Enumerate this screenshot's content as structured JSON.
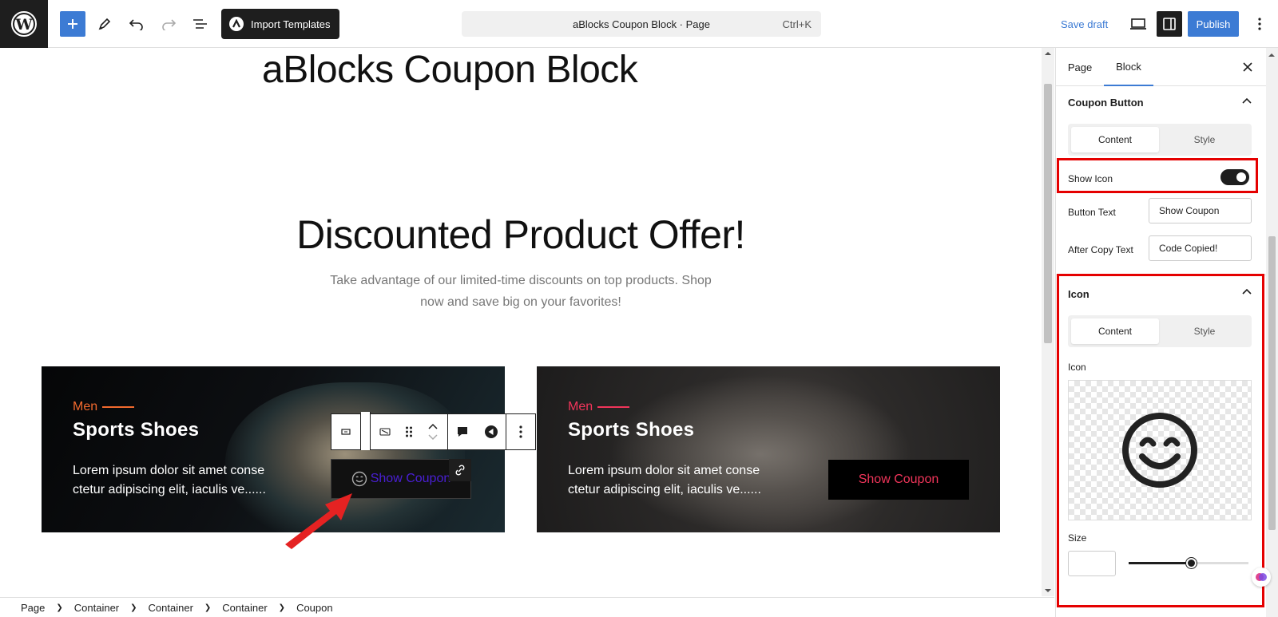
{
  "topbar": {
    "import_label": "Import Templates",
    "document_title": "aBlocks Coupon Block · Page",
    "shortcut": "Ctrl+K",
    "save_draft": "Save draft",
    "publish": "Publish"
  },
  "canvas": {
    "page_title": "aBlocks Coupon Block",
    "section_heading": "Discounted Product Offer!",
    "section_subtitle": "Take advantage of our limited-time discounts on top products. Shop now and save big on your favorites!",
    "cards": [
      {
        "category": "Men",
        "title": "Sports Shoes",
        "description": "Lorem ipsum dolor sit amet conse ctetur adipiscing elit, iaculis ve......",
        "button": "Show Coupon",
        "category_color": "#f26a2e",
        "button_text_color": "#4a1fd6"
      },
      {
        "category": "Men",
        "title": "Sports Shoes",
        "description": "Lorem ipsum dolor sit amet conse ctetur adipiscing elit, iaculis ve......",
        "button": "Show Coupon",
        "category_color": "#f0355a",
        "button_text_color": "#f0355a"
      }
    ]
  },
  "breadcrumb": [
    "Page",
    "Container",
    "Container",
    "Container",
    "Coupon"
  ],
  "sidebar": {
    "tabs": [
      "Page",
      "Block"
    ],
    "active_tab": "Block",
    "coupon_button_panel": {
      "title": "Coupon Button",
      "segments": [
        "Content",
        "Style"
      ],
      "show_icon_label": "Show Icon",
      "show_icon_on": true,
      "button_text_label": "Button Text",
      "button_text_value": "Show Coupon",
      "after_copy_label": "After Copy Text",
      "after_copy_value": "Code Copied!"
    },
    "icon_panel": {
      "title": "Icon",
      "segments": [
        "Content",
        "Style"
      ],
      "icon_label": "Icon",
      "icon_name": "smile-icon",
      "size_label": "Size",
      "size_slider_fraction": 0.52
    }
  },
  "colors": {
    "accent": "#3c7bd4",
    "highlight": "#e50000"
  }
}
